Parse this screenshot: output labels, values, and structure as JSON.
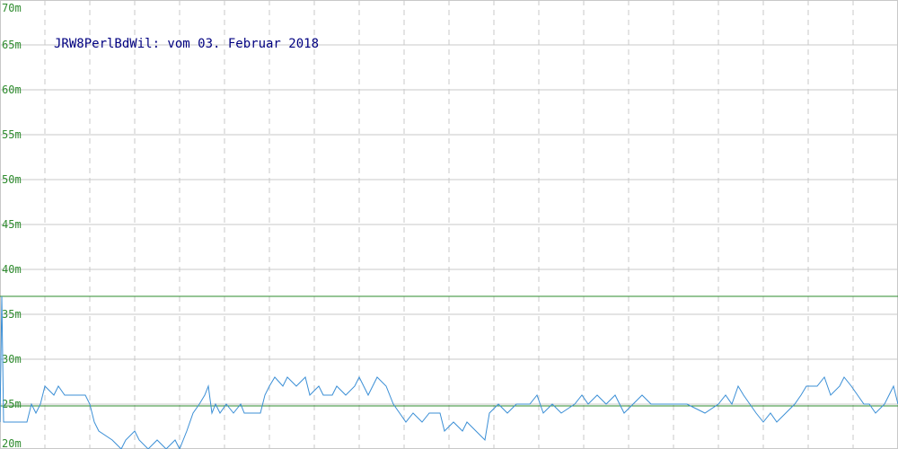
{
  "chart_data": {
    "type": "line",
    "title": "JRW8PerlBdWil: vom 03. Februar 2018",
    "xlabel": "",
    "ylabel": "",
    "ylim": [
      20,
      70
    ],
    "yticks": [
      "20m",
      "25m",
      "30m",
      "35m",
      "40m",
      "45m",
      "50m",
      "55m",
      "60m",
      "65m",
      "70m"
    ],
    "grid": true,
    "reference_lines": [
      {
        "kind": "max",
        "value": 37,
        "color": "#2e8b2e"
      },
      {
        "kind": "average",
        "value": 24.8,
        "color": "#2e8b2e"
      }
    ],
    "series": [
      {
        "color": "#3b8fd6",
        "x_range": [
          0,
          1000
        ],
        "points": [
          [
            0,
            23
          ],
          [
            2,
            37
          ],
          [
            4,
            23
          ],
          [
            30,
            23
          ],
          [
            35,
            25
          ],
          [
            40,
            24
          ],
          [
            45,
            25
          ],
          [
            50,
            27
          ],
          [
            60,
            26
          ],
          [
            65,
            27
          ],
          [
            72,
            26
          ],
          [
            95,
            26
          ],
          [
            100,
            25
          ],
          [
            105,
            23
          ],
          [
            110,
            22
          ],
          [
            125,
            21
          ],
          [
            135,
            20
          ],
          [
            140,
            21
          ],
          [
            150,
            22
          ],
          [
            155,
            21
          ],
          [
            165,
            20
          ],
          [
            175,
            21
          ],
          [
            185,
            20
          ],
          [
            195,
            21
          ],
          [
            200,
            20
          ],
          [
            208,
            22
          ],
          [
            215,
            24
          ],
          [
            222,
            25
          ],
          [
            228,
            26
          ],
          [
            232,
            27
          ],
          [
            236,
            24
          ],
          [
            240,
            25
          ],
          [
            245,
            24
          ],
          [
            252,
            25
          ],
          [
            260,
            24
          ],
          [
            268,
            25
          ],
          [
            272,
            24
          ],
          [
            290,
            24
          ],
          [
            295,
            26
          ],
          [
            300,
            27
          ],
          [
            306,
            28
          ],
          [
            315,
            27
          ],
          [
            320,
            28
          ],
          [
            330,
            27
          ],
          [
            340,
            28
          ],
          [
            345,
            26
          ],
          [
            355,
            27
          ],
          [
            360,
            26
          ],
          [
            370,
            26
          ],
          [
            375,
            27
          ],
          [
            385,
            26
          ],
          [
            395,
            27
          ],
          [
            400,
            28
          ],
          [
            410,
            26
          ],
          [
            415,
            27
          ],
          [
            420,
            28
          ],
          [
            430,
            27
          ],
          [
            438,
            25
          ],
          [
            445,
            24
          ],
          [
            452,
            23
          ],
          [
            460,
            24
          ],
          [
            470,
            23
          ],
          [
            478,
            24
          ],
          [
            490,
            24
          ],
          [
            495,
            22
          ],
          [
            505,
            23
          ],
          [
            515,
            22
          ],
          [
            520,
            23
          ],
          [
            530,
            22
          ],
          [
            540,
            21
          ],
          [
            545,
            24
          ],
          [
            555,
            25
          ],
          [
            565,
            24
          ],
          [
            575,
            25
          ],
          [
            590,
            25
          ],
          [
            598,
            26
          ],
          [
            605,
            24
          ],
          [
            615,
            25
          ],
          [
            625,
            24
          ],
          [
            640,
            25
          ],
          [
            648,
            26
          ],
          [
            655,
            25
          ],
          [
            665,
            26
          ],
          [
            675,
            25
          ],
          [
            685,
            26
          ],
          [
            695,
            24
          ],
          [
            705,
            25
          ],
          [
            715,
            26
          ],
          [
            725,
            25
          ],
          [
            740,
            25
          ],
          [
            765,
            25
          ],
          [
            785,
            24
          ],
          [
            800,
            25
          ],
          [
            808,
            26
          ],
          [
            815,
            25
          ],
          [
            822,
            27
          ],
          [
            828,
            26
          ],
          [
            835,
            25
          ],
          [
            842,
            24
          ],
          [
            850,
            23
          ],
          [
            858,
            24
          ],
          [
            865,
            23
          ],
          [
            875,
            24
          ],
          [
            885,
            25
          ],
          [
            892,
            26
          ],
          [
            898,
            27
          ],
          [
            910,
            27
          ],
          [
            918,
            28
          ],
          [
            925,
            26
          ],
          [
            935,
            27
          ],
          [
            940,
            28
          ],
          [
            948,
            27
          ],
          [
            955,
            26
          ],
          [
            962,
            25
          ],
          [
            968,
            25
          ],
          [
            975,
            24
          ],
          [
            985,
            25
          ],
          [
            990,
            26
          ],
          [
            995,
            27
          ],
          [
            1000,
            25
          ]
        ]
      }
    ]
  }
}
